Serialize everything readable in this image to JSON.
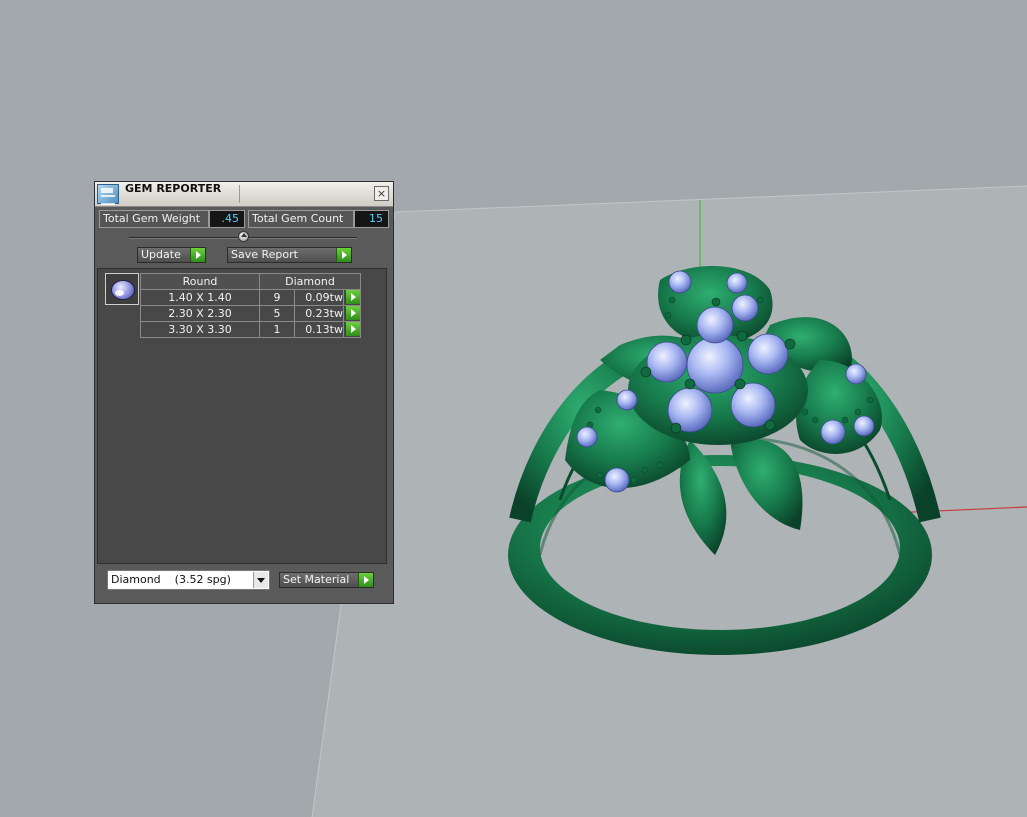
{
  "panel": {
    "title": "GEM REPORTER",
    "close_label": "×",
    "total_weight_label": "Total Gem Weight",
    "total_weight_value": ".45",
    "total_count_label": "Total Gem Count",
    "total_count_value": "15",
    "update_label": "Update",
    "save_report_label": "Save Report",
    "table": {
      "headers": [
        "Round",
        "Diamond"
      ],
      "rows": [
        {
          "size": "1.40 X 1.40",
          "count": "9",
          "weight": "0.09tw"
        },
        {
          "size": "2.30 X 2.30",
          "count": "5",
          "weight": "0.23tw"
        },
        {
          "size": "3.30 X 3.30",
          "count": "1",
          "weight": "0.13tw"
        }
      ]
    },
    "material_value": "Diamond    (3.52 spg)",
    "set_material_label": "Set Material"
  },
  "colors": {
    "viewport_bg": "#a3a8ac",
    "metal": "#1a7a4a",
    "gem": "#a9b8f2",
    "accent_go": "#3aa625",
    "value_text": "#5ad2ff"
  }
}
